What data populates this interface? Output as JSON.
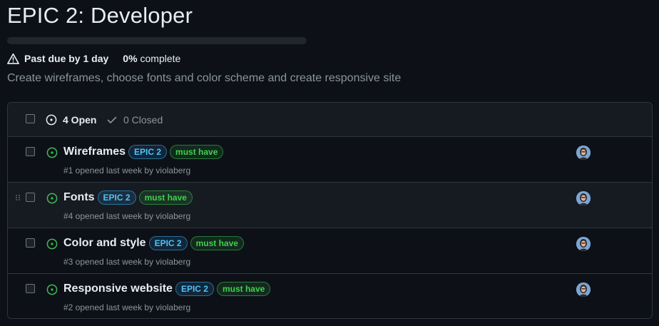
{
  "milestone": {
    "title": "EPIC 2: Developer",
    "progress_fraction": 0,
    "past_due_text": "Past due by 1 day",
    "percent_text": "0%",
    "complete_text": "complete",
    "description": "Create wireframes, choose fonts and color scheme and create responsive site"
  },
  "issues_header": {
    "open_label": "4 Open",
    "closed_label": "0 Closed"
  },
  "issues": [
    {
      "title": "Wireframes",
      "labels": [
        "EPIC 2",
        "must have"
      ],
      "meta": "#1 opened last week by violaberg"
    },
    {
      "title": "Fonts",
      "labels": [
        "EPIC 2",
        "must have"
      ],
      "meta": "#4 opened last week by violaberg"
    },
    {
      "title": "Color and style",
      "labels": [
        "EPIC 2",
        "must have"
      ],
      "meta": "#3 opened last week by violaberg"
    },
    {
      "title": "Responsive website",
      "labels": [
        "EPIC 2",
        "must have"
      ],
      "meta": "#2 opened last week by violaberg"
    }
  ],
  "colors": {
    "background": "#0d1117",
    "border": "#30363d",
    "open_green": "#3fb950",
    "epic_label": "#4fc3f7",
    "must_have_label": "#3fd14b",
    "muted_text": "#8b949e"
  },
  "icons": {
    "warning": "alert-triangle-icon",
    "open_issue": "issue-opened-icon",
    "closed_check": "check-icon",
    "drag": "grabber-icon"
  }
}
